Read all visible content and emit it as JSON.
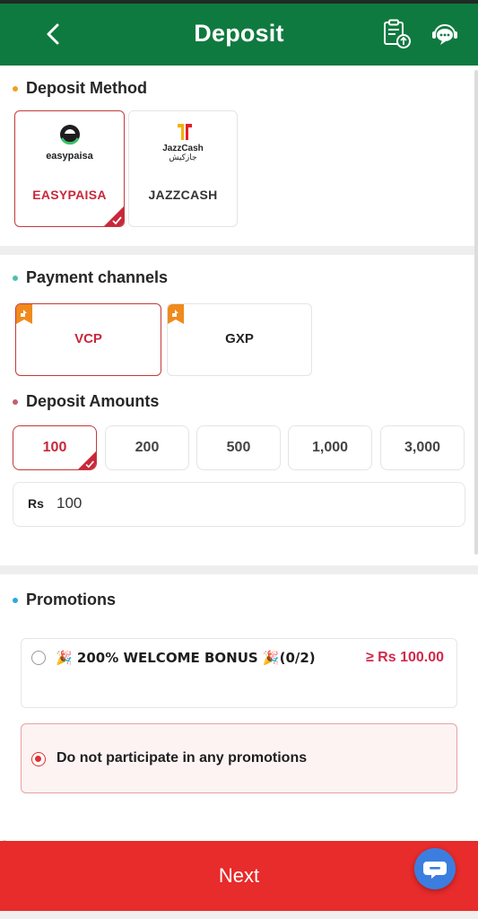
{
  "header": {
    "title": "Deposit",
    "back_icon": "chevron-left-icon",
    "history_icon": "clipboard-upload-icon",
    "support_icon": "chat-support-icon",
    "color": "#0f7a3f"
  },
  "deposit_method": {
    "title": "Deposit Method",
    "dot_color": "#f0a020",
    "methods": [
      {
        "label": "EASYPAISA",
        "logo_text": "easypaisa",
        "selected": true
      },
      {
        "label": "JAZZCASH",
        "logo_text": "JazzCash",
        "logo_subtext": "جازکیش",
        "selected": false
      }
    ]
  },
  "payment_channels": {
    "title": "Payment channels",
    "dot_color": "#4cc0b0",
    "channels": [
      {
        "label": "VCP",
        "selected": true
      },
      {
        "label": "GXP",
        "selected": false
      }
    ]
  },
  "deposit_amounts": {
    "title": "Deposit Amounts",
    "dot_color": "#c06070",
    "options": [
      "100",
      "200",
      "500",
      "1,000",
      "3,000"
    ],
    "selected": "100",
    "input": {
      "currency": "Rs",
      "value": "100"
    }
  },
  "promotions": {
    "title": "Promotions",
    "dot_color": "#2aa8e0",
    "items": [
      {
        "label": "🎉 200% WELCOME BONUS 🎉(0/2)",
        "amount": "≥ Rs 100.00",
        "selected": false
      },
      {
        "label": "Do not participate in any promotions",
        "selected": true
      }
    ]
  },
  "footer": {
    "next_label": "Next",
    "accent": "#e82b2b",
    "chat_icon": "chat-bubble-icon"
  }
}
